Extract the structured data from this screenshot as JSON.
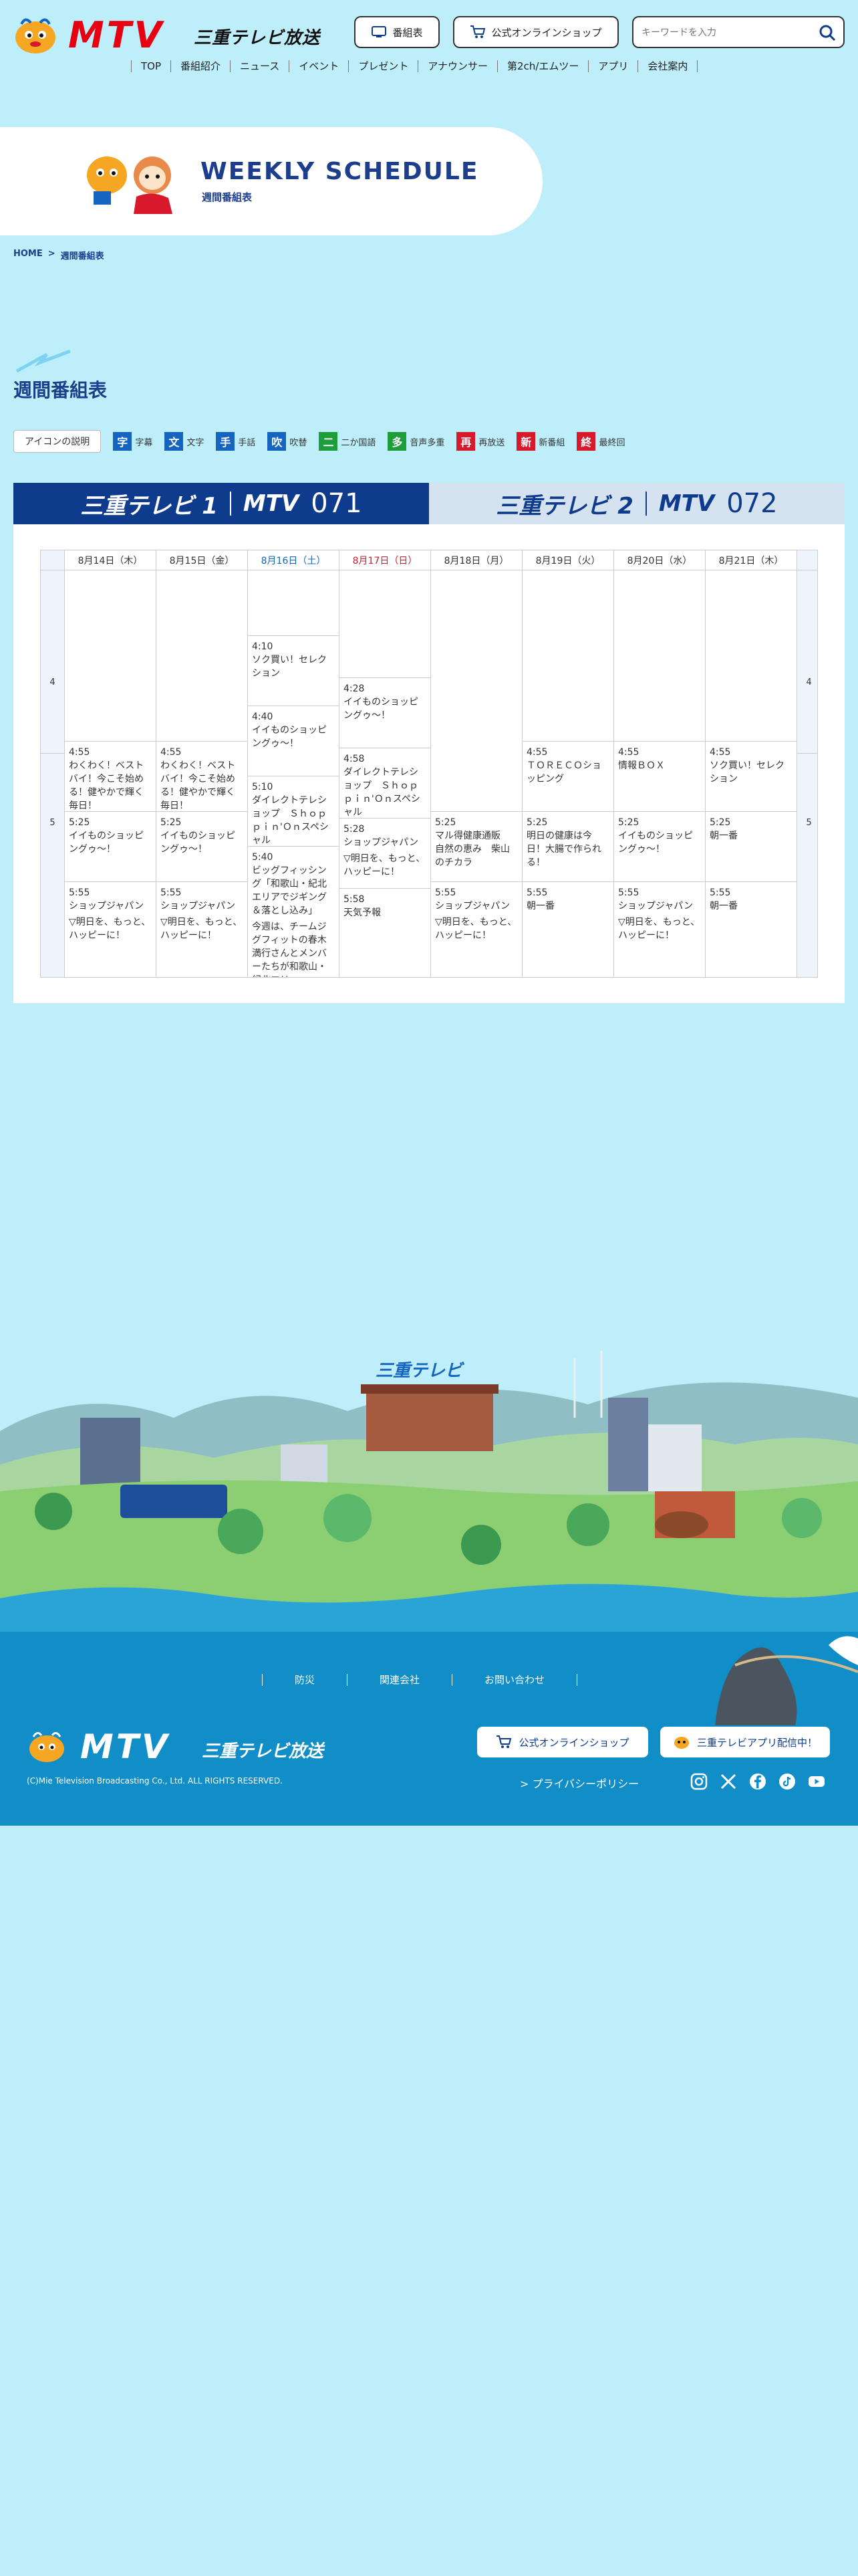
{
  "header": {
    "logo_text": "MTV",
    "logo_name": "三重テレビ放送",
    "guide_button": "番組表",
    "shop_button": "公式オンラインショップ",
    "search_placeholder": "キーワードを入力",
    "nav": [
      "TOP",
      "番組紹介",
      "ニュース",
      "イベント",
      "プレゼント",
      "アナウンサー",
      "第2ch/エムツー",
      "アプリ",
      "会社案内"
    ]
  },
  "hero": {
    "title": "WEEKLY SCHEDULE",
    "subtitle": "週間番組表"
  },
  "breadcrumb": {
    "home": "HOME",
    "separator": ">",
    "current": "週間番組表"
  },
  "section_title": "週間番組表",
  "legend": {
    "button": "アイコンの説明",
    "items": [
      {
        "icon": "字",
        "label": "字幕",
        "color": "#1565c0"
      },
      {
        "icon": "文",
        "label": "文字",
        "color": "#1565c0"
      },
      {
        "icon": "手",
        "label": "手話",
        "color": "#1565c0"
      },
      {
        "icon": "吹",
        "label": "吹替",
        "color": "#1565c0"
      },
      {
        "icon": "二",
        "label": "二か国語",
        "color": "#1e9e3a"
      },
      {
        "icon": "多",
        "label": "音声多重",
        "color": "#1e9e3a"
      },
      {
        "icon": "再",
        "label": "再放送",
        "color": "#d7192b"
      },
      {
        "icon": "新",
        "label": "新番組",
        "color": "#d7192b"
      },
      {
        "icon": "終",
        "label": "最終回",
        "color": "#d7192b"
      }
    ]
  },
  "channels": {
    "ch1": {
      "name": "三重テレビ 1",
      "brand": "MTV",
      "number": "071"
    },
    "ch2": {
      "name": "三重テレビ 2",
      "brand": "MTV",
      "number": "072"
    }
  },
  "schedule": {
    "hours": [
      "4",
      "5"
    ],
    "days": [
      {
        "date": "8月14日（木）",
        "color": "#333333",
        "programs": [
          {
            "time": "",
            "title": "",
            "desc": ""
          },
          {
            "time": "4:55",
            "title": "わくわく！ベストバイ！今こそ始める！健やかで輝く毎日！",
            "desc": ""
          },
          {
            "time": "5:25",
            "title": "イイものショッピングゥ〜！",
            "desc": ""
          },
          {
            "time": "5:55",
            "title": "ショップジャパン",
            "desc": "▽明日を、もっと、ハッピーに！"
          }
        ]
      },
      {
        "date": "8月15日（金）",
        "color": "#333333",
        "programs": [
          {
            "time": "",
            "title": "",
            "desc": ""
          },
          {
            "time": "4:55",
            "title": "わくわく！ベストバイ！今こそ始める！健やかで輝く毎日！",
            "desc": ""
          },
          {
            "time": "5:25",
            "title": "イイものショッピングゥ〜！",
            "desc": ""
          },
          {
            "time": "5:55",
            "title": "ショップジャパン",
            "desc": "▽明日を、もっと、ハッピーに！"
          }
        ]
      },
      {
        "date": "8月16日（土）",
        "color": "#1565c0",
        "programs": [
          {
            "time": "",
            "title": "",
            "desc": ""
          },
          {
            "time": "4:10",
            "title": "ソク買い！セレクション",
            "desc": ""
          },
          {
            "time": "4:40",
            "title": "イイものショッピングゥ〜！",
            "desc": ""
          },
          {
            "time": "5:10",
            "title": "ダイレクトテレショップ　Ｓｈｏｐｐｉｎ'Ｏｎスペシャル",
            "desc": ""
          },
          {
            "time": "5:40",
            "title": "ビッグフィッシング「和歌山・紀北エリアでジギング＆落とし込み」",
            "desc": "今週は、チームジグフィットの春木満行さんとメンバーたちが和歌山・紀北エリ"
          }
        ]
      },
      {
        "date": "8月17日（日）",
        "color": "#d7192b",
        "programs": [
          {
            "time": "",
            "title": "",
            "desc": ""
          },
          {
            "time": "4:28",
            "title": "イイものショッピングゥ〜！",
            "desc": ""
          },
          {
            "time": "4:58",
            "title": "ダイレクトテレショップ　Ｓｈｏｐｐｉｎ'Ｏｎスペシャル",
            "desc": ""
          },
          {
            "time": "5:28",
            "title": "ショップジャパン",
            "desc": "▽明日を、もっと、ハッピーに！"
          },
          {
            "time": "5:58",
            "title": "天気予報",
            "desc": ""
          }
        ]
      },
      {
        "date": "8月18日（月）",
        "color": "#333333",
        "programs": [
          {
            "time": "",
            "title": "",
            "desc": ""
          },
          {
            "time": "5:25",
            "title": "マル得健康通販　自然の恵み　柴山のチカラ",
            "desc": ""
          },
          {
            "time": "5:55",
            "title": "ショップジャパン",
            "desc": "▽明日を、もっと、ハッピーに！"
          }
        ]
      },
      {
        "date": "8月19日（火）",
        "color": "#333333",
        "programs": [
          {
            "time": "",
            "title": "",
            "desc": ""
          },
          {
            "time": "4:55",
            "title": "ＴＯＲＥＣＯショッピング",
            "desc": ""
          },
          {
            "time": "5:25",
            "title": "明日の健康は今日！大腸で作られる！",
            "desc": ""
          },
          {
            "time": "5:55",
            "title": "朝一番",
            "desc": ""
          }
        ]
      },
      {
        "date": "8月20日（水）",
        "color": "#333333",
        "programs": [
          {
            "time": "",
            "title": "",
            "desc": ""
          },
          {
            "time": "4:55",
            "title": "情報ＢＯＸ",
            "desc": ""
          },
          {
            "time": "5:25",
            "title": "イイものショッピングゥ〜！",
            "desc": ""
          },
          {
            "time": "5:55",
            "title": "ショップジャパン",
            "desc": "▽明日を、もっと、ハッピーに！"
          }
        ]
      },
      {
        "date": "8月21日（木）",
        "color": "#333333",
        "programs": [
          {
            "time": "",
            "title": "",
            "desc": ""
          },
          {
            "time": "4:55",
            "title": "ソク買い！セレクション",
            "desc": ""
          },
          {
            "time": "5:25",
            "title": "朝一番",
            "desc": ""
          },
          {
            "time": "5:55",
            "title": "朝一番",
            "desc": ""
          }
        ]
      }
    ]
  },
  "illustration": {
    "building_sign": "三重テレビ"
  },
  "footer": {
    "nav": [
      "防災",
      "関連会社",
      "お問い合わせ"
    ],
    "logo_text": "MTV",
    "logo_name": "三重テレビ放送",
    "copyright": "(C)Mie Television Broadcasting Co., Ltd. ALL RIGHTS RESERVED.",
    "shop_button": "公式オンラインショップ",
    "app_button": "三重テレビアプリ配信中！",
    "privacy": "> プライバシーポリシー",
    "social": [
      "instagram-icon",
      "x-icon",
      "facebook-icon",
      "tiktok-icon",
      "youtube-icon"
    ]
  }
}
